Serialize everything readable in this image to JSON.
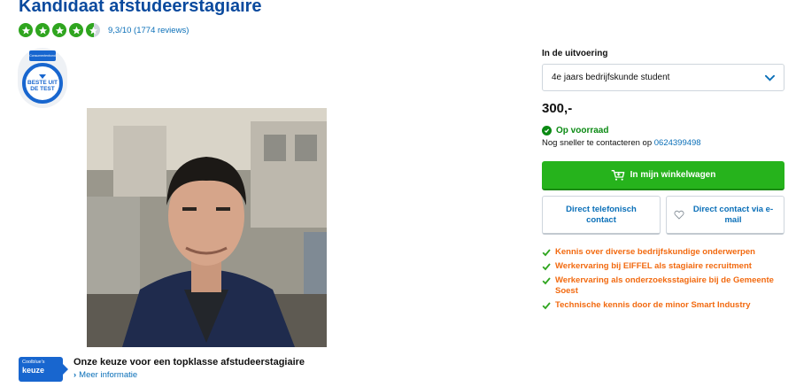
{
  "product": {
    "title": "Kandidaat afstudeerstagiaire",
    "rating": {
      "stars_filled": 4.5,
      "stars_total": 5,
      "text": "9,3/10 (1774 reviews)",
      "star_color": "#2fa51f"
    },
    "badge": {
      "flag_text": "Consumentenbond",
      "text": "BESTE UIT DE TEST",
      "color": "#1866cf"
    },
    "image_alt": "Portretfoto kandidaat",
    "choice": {
      "logo_small": "Coolblue's",
      "logo_big": "keuze",
      "title": "Onze keuze voor een topklasse afstudeerstagiaire",
      "more_link": "Meer informatie"
    }
  },
  "purchase": {
    "variant_label": "In de uitvoering",
    "variant_selected": "4e jaars bedrijfskunde student",
    "price": "300,-",
    "stock_status": "Op voorraad",
    "contact_prefix": "Nog sneller te contacteren op",
    "contact_phone": "0624399498",
    "cart_button": "In mijn winkelwagen",
    "phone_button": "Direct telefonisch contact",
    "mail_button": "Direct contact via e-mail",
    "accent_green": "#26b31c",
    "pros_color": "#f26a10"
  },
  "pros": [
    "Kennis over diverse bedrijfskundige onderwerpen",
    "Werkervaring bij EIFFEL als stagiaire recruitment",
    "Werkervaring als onderzoeksstagiaire bij de Gemeente Soest",
    "Technische kennis door de minor Smart Industry"
  ]
}
